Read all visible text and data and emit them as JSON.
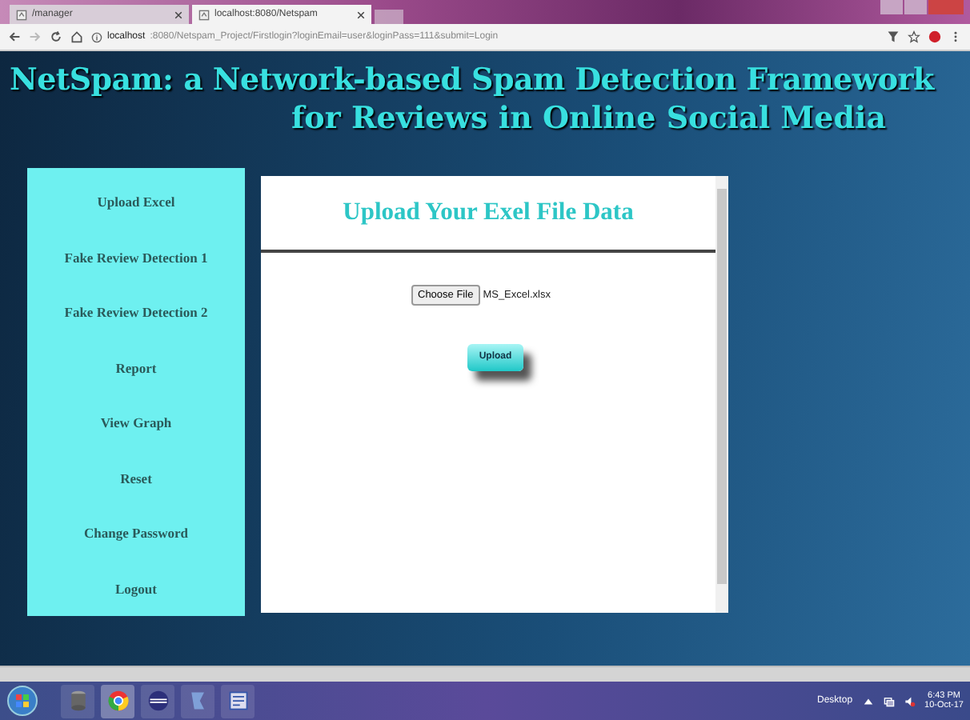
{
  "browser": {
    "tabs": [
      {
        "title": "/manager",
        "selected": false
      },
      {
        "title": "localhost:8080/Netspam",
        "selected": true
      }
    ],
    "url_host": "localhost",
    "url_rest": ":8080/Netspam_Project/Firstlogin?loginEmail=user&loginPass=111&submit=Login"
  },
  "header": {
    "line_1": "NetSpam: a Network-based Spam Detection Framework",
    "line_2": "for Reviews in Online Social Media"
  },
  "sidebar": {
    "items": [
      {
        "label": "Upload Excel"
      },
      {
        "label": "Fake Review Detection 1"
      },
      {
        "label": "Fake Review Detection 2"
      },
      {
        "label": "Report"
      },
      {
        "label": "View Graph"
      },
      {
        "label": "Reset"
      },
      {
        "label": "Change Password"
      },
      {
        "label": "Logout"
      }
    ]
  },
  "panel": {
    "title": "Upload Your Exel File Data",
    "choose_button": "Choose File",
    "file_name": "MS_Excel.xlsx",
    "upload_button": "Upload"
  },
  "taskbar": {
    "desktop_label": "Desktop",
    "time": "6:43 PM",
    "date": "10-Oct-17"
  }
}
